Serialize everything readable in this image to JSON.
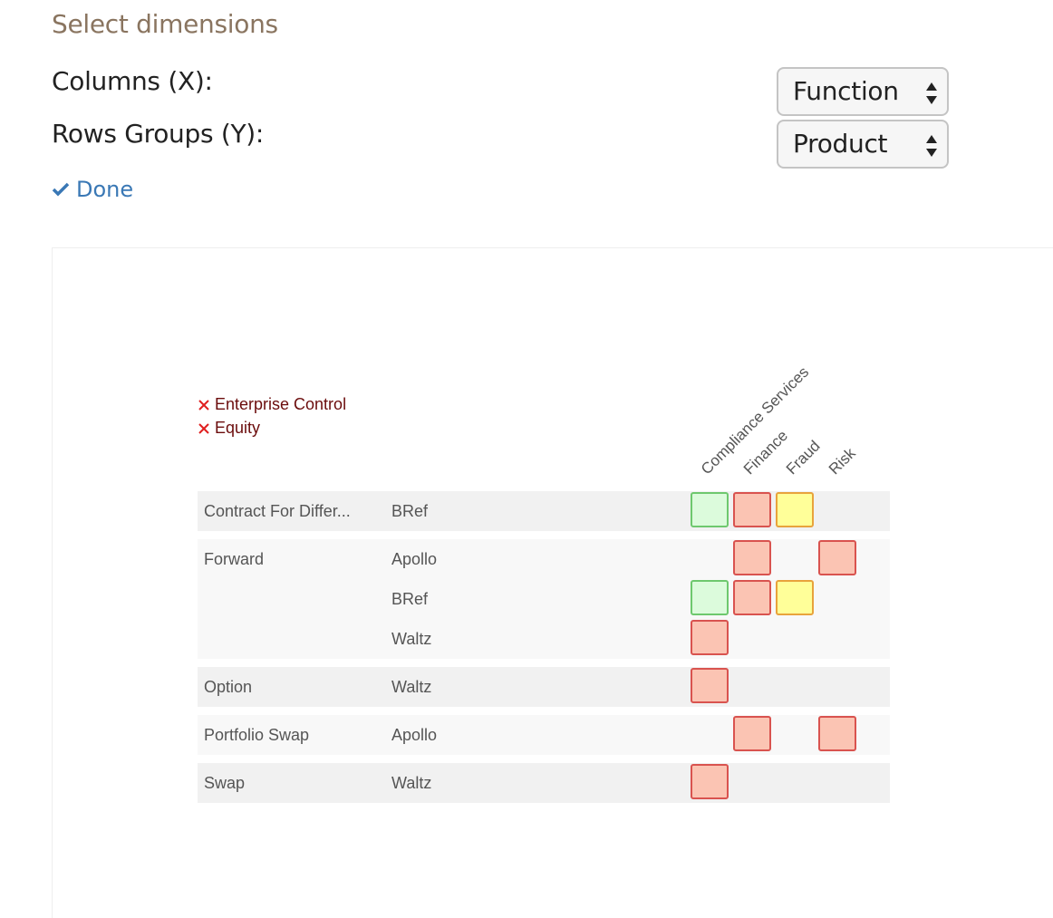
{
  "heading": "Select dimensions",
  "dimensions": {
    "columns_label": "Columns (X):",
    "rows_label": "Rows Groups (Y):",
    "columns_value": "Function",
    "rows_value": "Product",
    "done_label": "Done"
  },
  "filters": [
    "Enterprise Control",
    "Equity"
  ],
  "matrix": {
    "columns": [
      "Compliance Services",
      "Finance",
      "Fraud",
      "Risk"
    ],
    "status_colors": {
      "g": "#dcfbdc",
      "r": "#fbc4b3",
      "y": "#ffff99"
    },
    "groups": [
      {
        "product": "Contract For Differ...",
        "rows": [
          {
            "app": "BRef",
            "cells": [
              "g",
              "r",
              "y",
              ""
            ]
          }
        ]
      },
      {
        "product": "Forward",
        "rows": [
          {
            "app": "Apollo",
            "cells": [
              "",
              "r",
              "",
              "r"
            ]
          },
          {
            "app": "BRef",
            "cells": [
              "g",
              "r",
              "y",
              ""
            ]
          },
          {
            "app": "Waltz",
            "cells": [
              "r",
              "",
              "",
              ""
            ]
          }
        ]
      },
      {
        "product": "Option",
        "rows": [
          {
            "app": "Waltz",
            "cells": [
              "r",
              "",
              "",
              ""
            ]
          }
        ]
      },
      {
        "product": "Portfolio Swap",
        "rows": [
          {
            "app": "Apollo",
            "cells": [
              "",
              "r",
              "",
              "r"
            ]
          }
        ]
      },
      {
        "product": "Swap",
        "rows": [
          {
            "app": "Waltz",
            "cells": [
              "r",
              "",
              "",
              ""
            ]
          }
        ]
      }
    ]
  }
}
